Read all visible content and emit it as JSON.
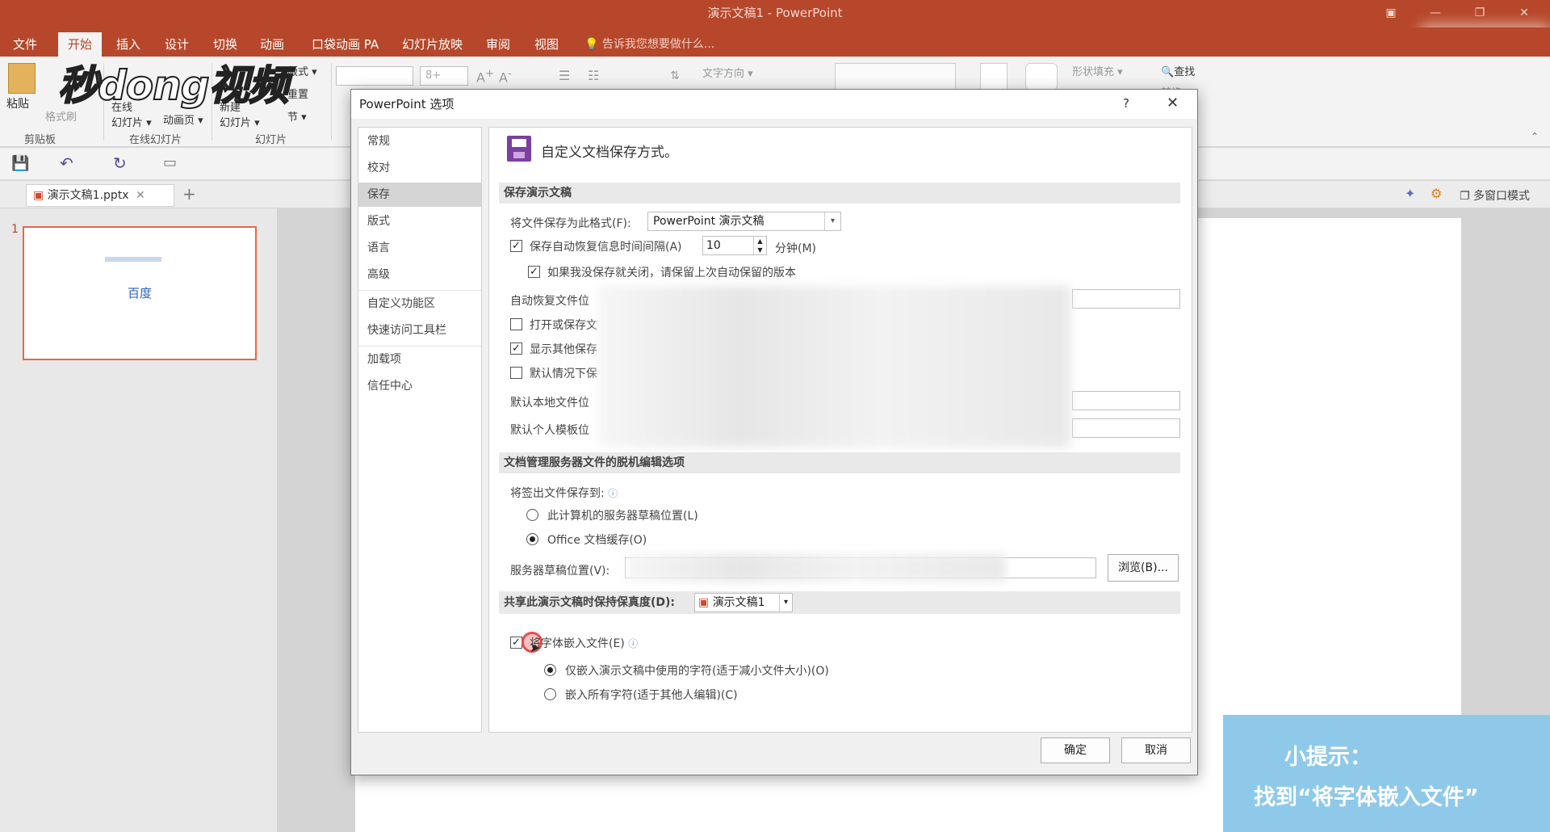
{
  "window": {
    "title": "演示文稿1 - PowerPoint"
  },
  "watermark": {
    "text": "秒dong视频"
  },
  "ribbon_tabs": [
    "文件",
    "开始",
    "插入",
    "设计",
    "切换",
    "动画",
    "口袋动画 PA",
    "幻灯片放映",
    "审阅",
    "视图"
  ],
  "tell_me": "告诉我您想要做什么...",
  "ribbon": {
    "paste": "粘贴",
    "format_painter": "格式刷",
    "clipboard_group": "剪贴板",
    "online_slide": "在线\n幻灯片",
    "anim_page": "动画页",
    "online_group": "在线幻灯片",
    "new_slide": "新建\n幻灯片",
    "layout": "版式",
    "reset": "重置",
    "section": "节",
    "slides_group": "幻灯片",
    "font_size": "8+",
    "text_direction": "文字方向",
    "shape_fill": "形状填充",
    "find": "查找",
    "replace": "替换"
  },
  "doc_tab": {
    "name": "演示文稿1.pptx"
  },
  "multiwindow": "多窗口模式",
  "thumbnail": {
    "number": "1",
    "text": "百度"
  },
  "dialog": {
    "title": "PowerPoint 选项",
    "help": "?",
    "close": "✕",
    "nav": [
      "常规",
      "校对",
      "保存",
      "版式",
      "语言",
      "高级",
      "自定义功能区",
      "快速访问工具栏",
      "加载项",
      "信任中心"
    ],
    "nav_active": "保存",
    "header": "自定义文档保存方式。",
    "section_save": "保存演示文稿",
    "format_label": "将文件保存为此格式(F):",
    "format_value": "PowerPoint 演示文稿",
    "autorecover_label": "保存自动恢复信息时间间隔(A)",
    "autorecover_value": "10",
    "minutes_label": "分钟(M)",
    "keep_last_label": "如果我没保存就关闭，请保留上次自动保留的版本",
    "autorecover_location": "自动恢复文件位",
    "open_save_label": "打开或保存文",
    "show_other_label": "显示其他保存",
    "default_label": "默认情况下保",
    "default_local_label": "默认本地文件位",
    "default_template_label": "默认个人模板位",
    "section_offline": "文档管理服务器文件的脱机编辑选项",
    "checkout_label": "将签出文件保存到:",
    "radio_server_drafts": "此计算机的服务器草稿位置(L)",
    "radio_office_cache": "Office 文档缓存(O)",
    "server_drafts_label": "服务器草稿位置(V):",
    "browse_button": "浏览(B)...",
    "section_fidelity": "共享此演示文稿时保持保真度(D):",
    "fidelity_doc": "演示文稿1",
    "embed_fonts_label": "将字体嵌入文件(E)",
    "embed_used_label": "仅嵌入演示文稿中使用的字符(适于减小文件大小)(O)",
    "embed_all_label": "嵌入所有字符(适于其他人编辑)(C)",
    "ok_button": "确定",
    "cancel_button": "取消"
  },
  "hint": {
    "line1": "小提示：",
    "line2": "找到“将字体嵌入文件”"
  },
  "colors": {
    "accent": "#b7472a",
    "hint_bg": "#8ec9ea",
    "dialog_bg": "#f0f0f0"
  }
}
